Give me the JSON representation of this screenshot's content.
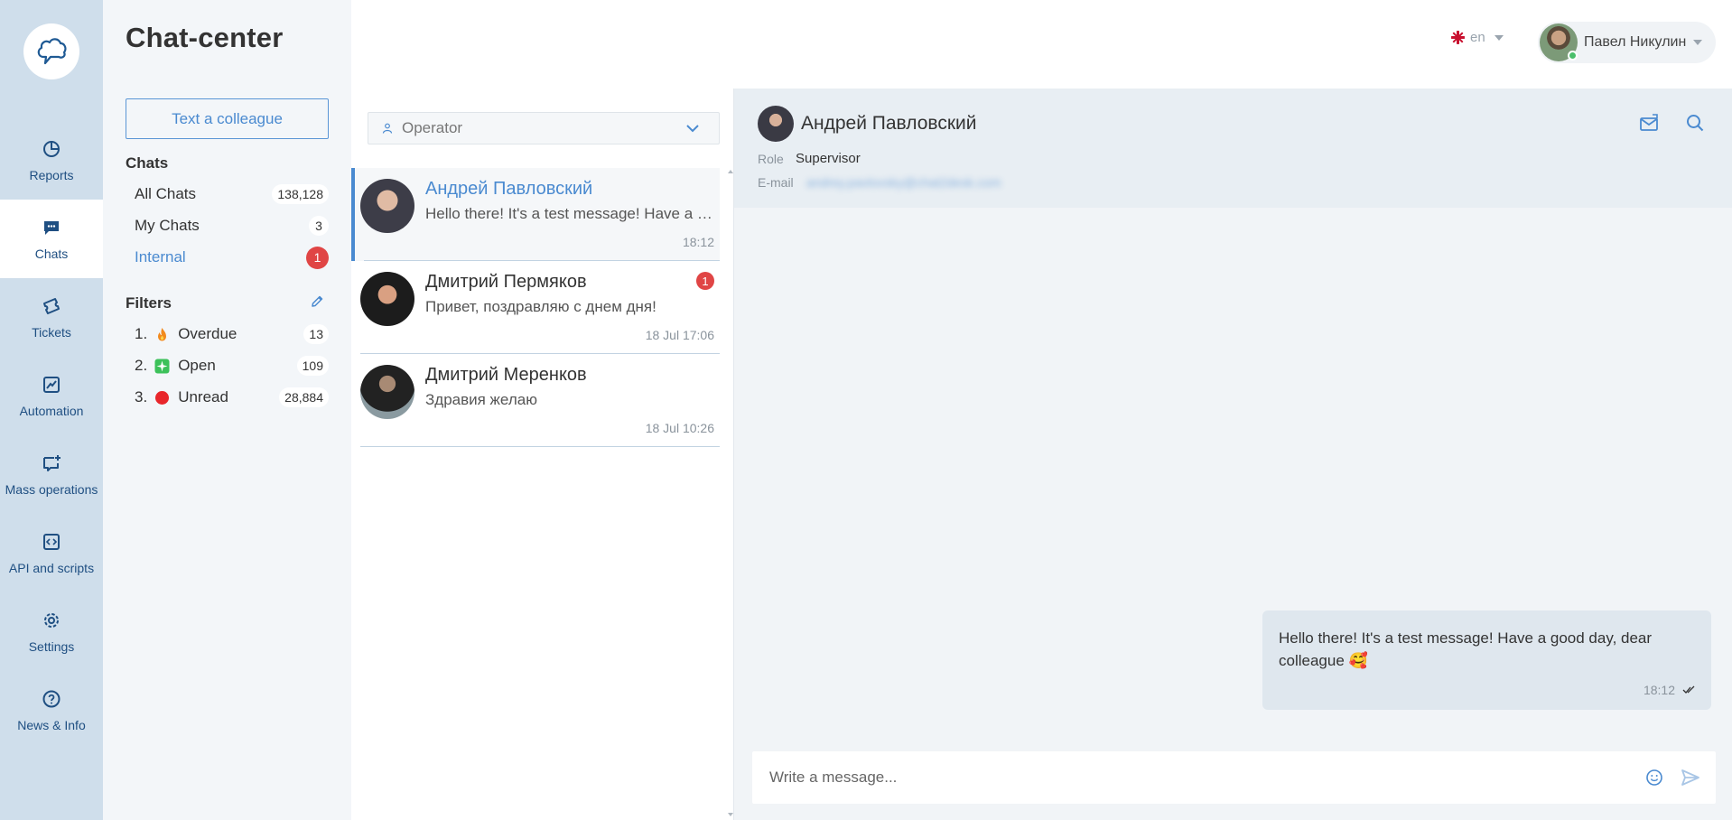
{
  "app": {
    "title": "Chat-center"
  },
  "nav": {
    "items": [
      {
        "label": "Reports",
        "icon": "pie-chart-icon"
      },
      {
        "label": "Chats",
        "icon": "chat-bubble-icon"
      },
      {
        "label": "Tickets",
        "icon": "ticket-icon"
      },
      {
        "label": "Automation",
        "icon": "chart-trend-icon"
      },
      {
        "label": "Mass operations",
        "icon": "chat-plus-icon"
      },
      {
        "label": "API and scripts",
        "icon": "code-icon"
      },
      {
        "label": "Settings",
        "icon": "gear-icon"
      },
      {
        "label": "News & Info",
        "icon": "question-icon"
      }
    ],
    "active": "Chats"
  },
  "panel": {
    "colleague_button": "Text a colleague",
    "chats_heading": "Chats",
    "chats": [
      {
        "label": "All Chats",
        "count": "138,128"
      },
      {
        "label": "My Chats",
        "count": "3"
      },
      {
        "label": "Internal",
        "count": "1"
      }
    ],
    "filters_heading": "Filters",
    "filters": [
      {
        "num": "1.",
        "label": "Overdue",
        "count": "13",
        "icon": "fire-icon"
      },
      {
        "num": "2.",
        "label": "Open",
        "count": "109",
        "icon": "sparkle-icon"
      },
      {
        "num": "3.",
        "label": "Unread",
        "count": "28,884",
        "icon": "red-circle-icon"
      }
    ]
  },
  "topbar": {
    "language": "en",
    "user_name": "Павел Никулин"
  },
  "list": {
    "operator_placeholder": "Operator",
    "items": [
      {
        "name": "Андрей Павловский",
        "message": "Hello there! It's a test message! Have a good day, dear colleague",
        "time": "18:12",
        "badge": ""
      },
      {
        "name": "Дмитрий Пермяков",
        "message": "Привет, поздравляю с днем дня!",
        "time": "18 Jul 17:06",
        "badge": "1"
      },
      {
        "name": "Дмитрий Меренков",
        "message": "Здравия желаю",
        "time": "18 Jul 10:26",
        "badge": ""
      }
    ]
  },
  "conversation": {
    "contact_name": "Андрей Павловский",
    "role_label": "Role",
    "role_value": "Supervisor",
    "email_label": "E-mail",
    "email_value": "andrey.pavlovsky@chat2desk.com",
    "messages": [
      {
        "text": "Hello there! It's a test message! Have a good day, dear colleague 🥰",
        "time": "18:12"
      }
    ],
    "composer_placeholder": "Write a message..."
  },
  "colors": {
    "accent": "#4a8ad0",
    "rail": "#cfdeeb",
    "badge_red": "#e04545"
  }
}
